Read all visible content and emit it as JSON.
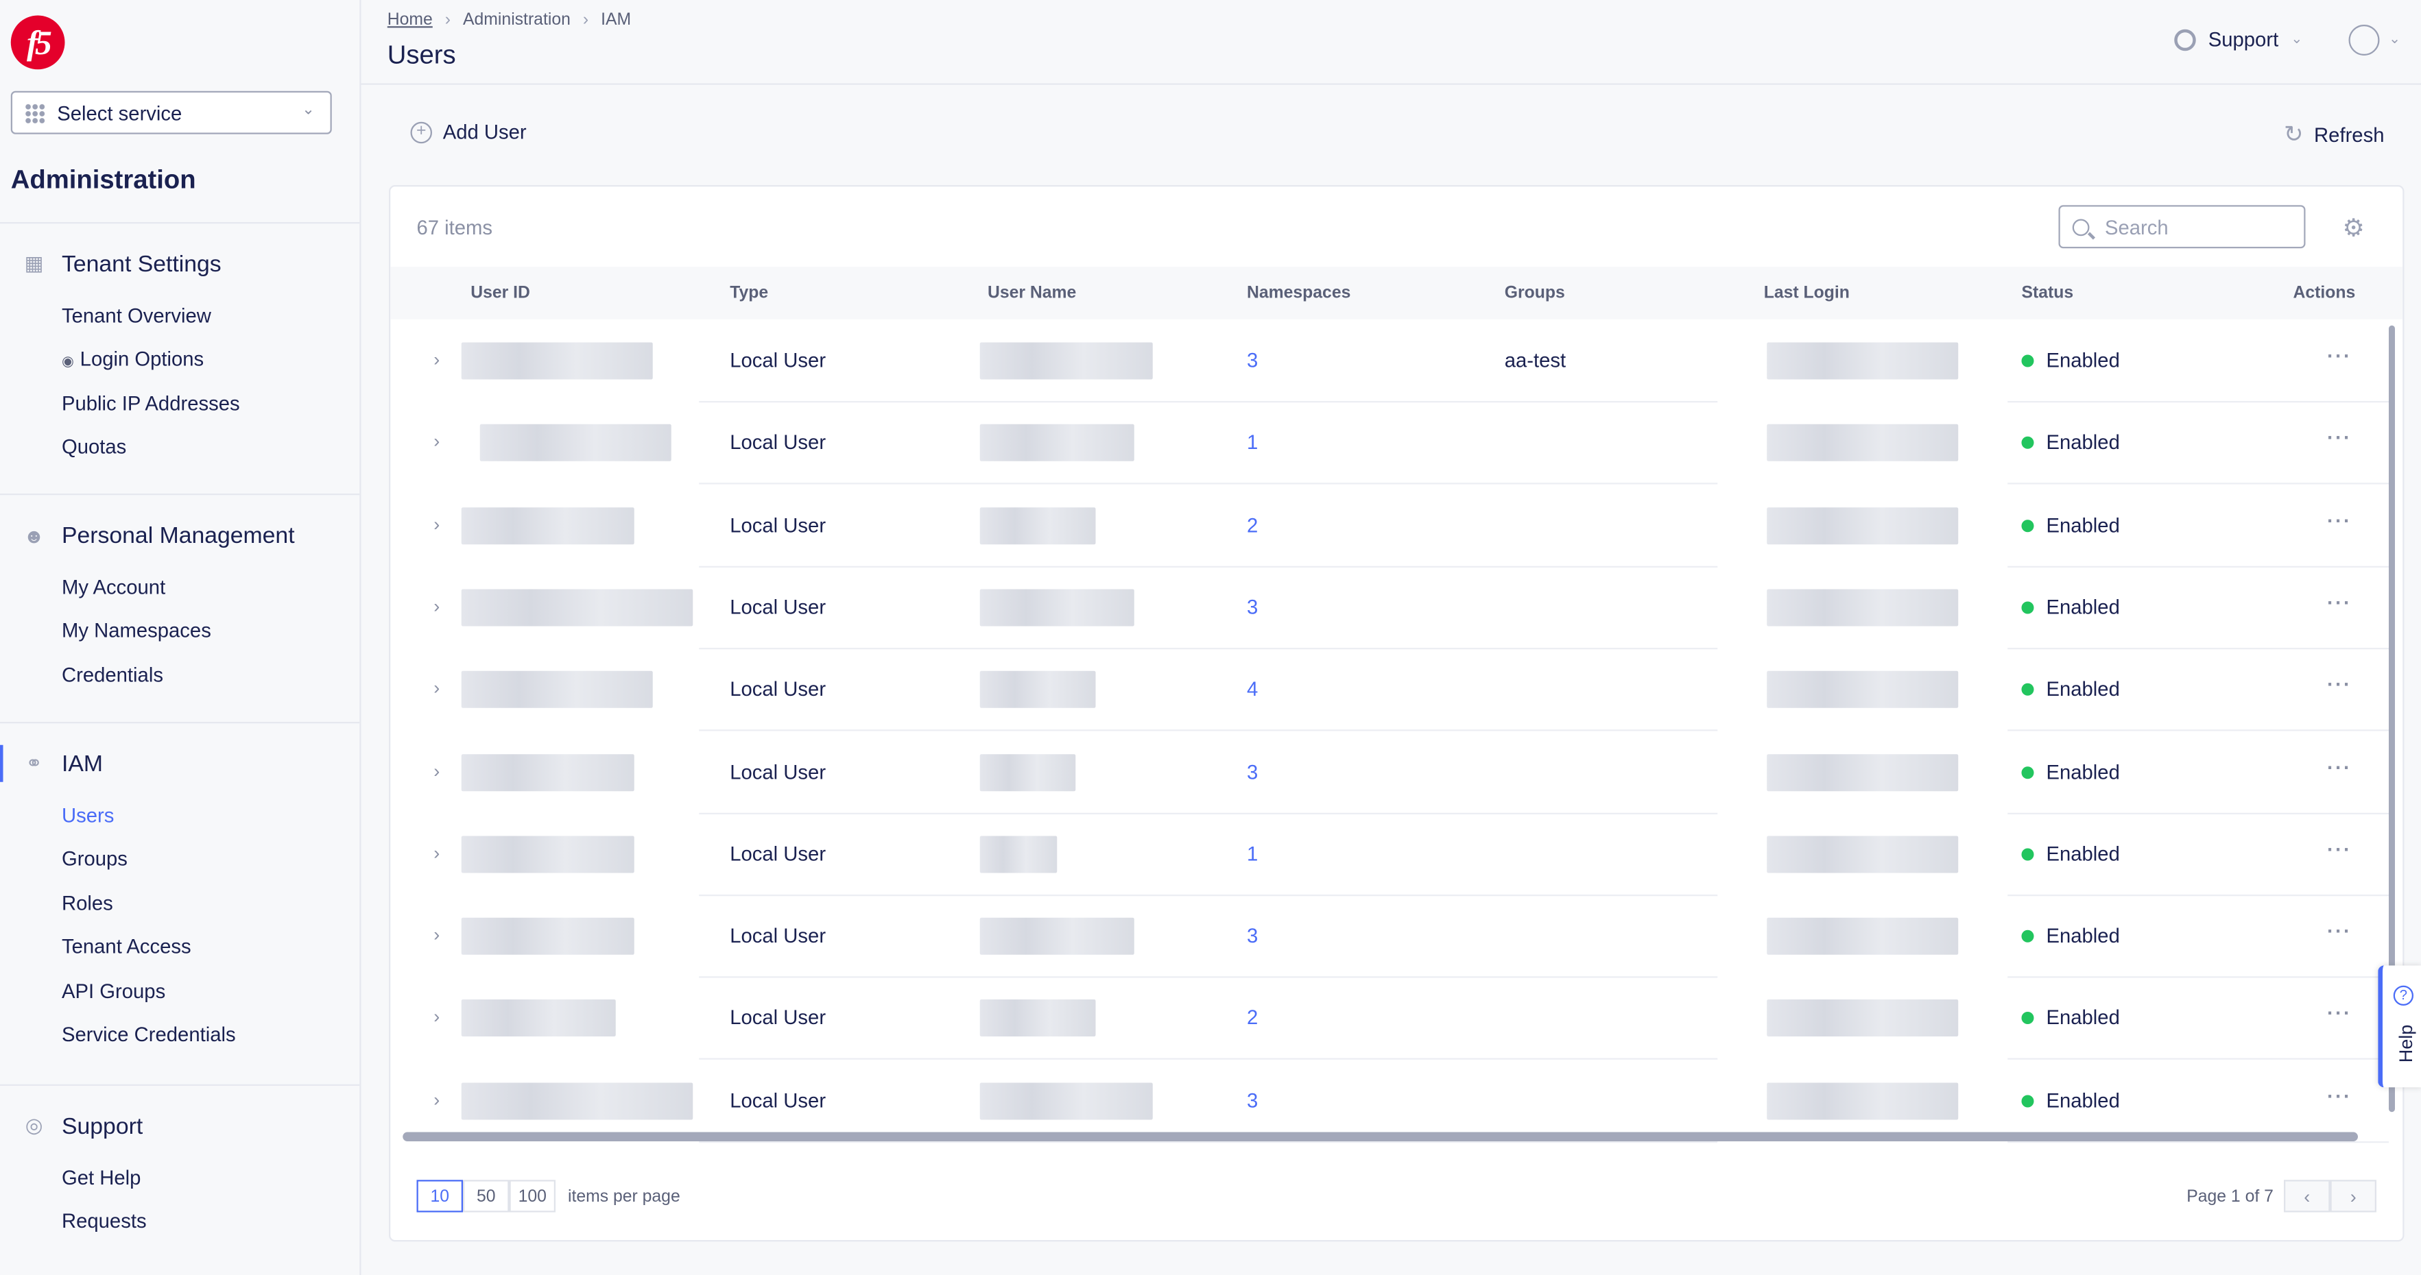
{
  "sidebar": {
    "logo": "f5",
    "select_service": "Select service",
    "title": "Administration",
    "sections": [
      {
        "label": "Tenant Settings",
        "icon": "building-icon",
        "items": [
          "Tenant Overview",
          "Login Options",
          "Public IP Addresses",
          "Quotas"
        ]
      },
      {
        "label": "Personal Management",
        "icon": "person-icon",
        "items": [
          "My Account",
          "My Namespaces",
          "Credentials"
        ]
      },
      {
        "label": "IAM",
        "icon": "key-icon",
        "items": [
          "Users",
          "Groups",
          "Roles",
          "Tenant Access",
          "API Groups",
          "Service Credentials"
        ]
      },
      {
        "label": "Support",
        "icon": "lifebuoy-icon",
        "items": [
          "Get Help",
          "Requests"
        ]
      }
    ],
    "active_item": "Users"
  },
  "header": {
    "breadcrumb": [
      "Home",
      "Administration",
      "IAM"
    ],
    "title": "Users",
    "support": "Support"
  },
  "toolbar": {
    "add_user": "Add User",
    "refresh": "Refresh"
  },
  "table": {
    "count": "67 items",
    "search_placeholder": "Search",
    "columns": [
      "User ID",
      "Type",
      "User Name",
      "Namespaces",
      "Groups",
      "Last Login",
      "Status",
      "Actions"
    ],
    "rows": [
      {
        "type": "Local User",
        "namespaces": "3",
        "groups": "aa-test",
        "status": "Enabled"
      },
      {
        "type": "Local User",
        "namespaces": "1",
        "groups": "",
        "status": "Enabled"
      },
      {
        "type": "Local User",
        "namespaces": "2",
        "groups": "",
        "status": "Enabled"
      },
      {
        "type": "Local User",
        "namespaces": "3",
        "groups": "",
        "status": "Enabled"
      },
      {
        "type": "Local User",
        "namespaces": "4",
        "groups": "",
        "status": "Enabled"
      },
      {
        "type": "Local User",
        "namespaces": "3",
        "groups": "",
        "status": "Enabled"
      },
      {
        "type": "Local User",
        "namespaces": "1",
        "groups": "",
        "status": "Enabled"
      },
      {
        "type": "Local User",
        "namespaces": "3",
        "groups": "",
        "status": "Enabled"
      },
      {
        "type": "Local User",
        "namespaces": "2",
        "groups": "",
        "status": "Enabled"
      },
      {
        "type": "Local User",
        "namespaces": "3",
        "groups": "",
        "status": "Enabled"
      }
    ],
    "page_sizes": [
      "10",
      "50",
      "100"
    ],
    "selected_page_size": "10",
    "items_per_page": "items per page",
    "page_info": "Page 1 of 7"
  },
  "help": "Help",
  "colors": {
    "accent": "#4a6cf7",
    "status_enabled": "#22c55e",
    "brand": "#e4002b",
    "text": "#1a2150"
  }
}
